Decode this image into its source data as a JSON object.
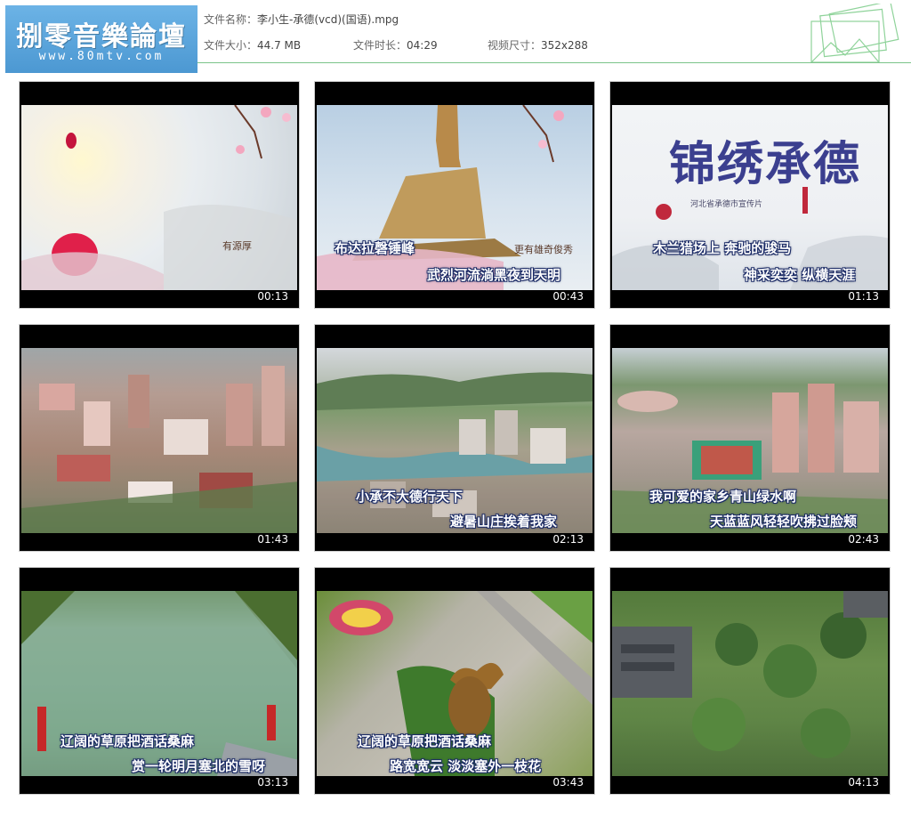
{
  "header": {
    "logo_title": "捌零音樂論壇",
    "logo_url": "www.80mtv.com",
    "file_name_label": "文件名称：",
    "file_name": "李小生-承德(vcd)(国语).mpg",
    "file_size_label": "文件大小：",
    "file_size": "44.7 MB",
    "duration_label": "文件时长：",
    "duration": "04:29",
    "dimensions_label": "视频尺寸：",
    "dimensions": "352x288"
  },
  "thumbnails": [
    {
      "time": "00:13",
      "sub1": "",
      "sub2": "",
      "overlay": "有源厚"
    },
    {
      "time": "00:43",
      "sub1": "布达拉磬锤峰",
      "sub2": "武烈河流淌黑夜到天明",
      "overlay": "更有雄奇俊秀"
    },
    {
      "time": "01:13",
      "sub1": "木兰猎场上 奔驰的骏马",
      "sub2": "神采奕奕 纵横天涯",
      "overlay": "锦绣承德",
      "overlay_small": "河北省承德市宣传片"
    },
    {
      "time": "01:43",
      "sub1": "",
      "sub2": ""
    },
    {
      "time": "02:13",
      "sub1": "小承不大德行天下",
      "sub2": "避暑山庄挨着我家"
    },
    {
      "time": "02:43",
      "sub1": "我可爱的家乡青山绿水啊",
      "sub2": "天蓝蓝风轻轻吹拂过脸颊"
    },
    {
      "time": "03:13",
      "sub1": "辽阔的草原把酒话桑麻",
      "sub2": "赏一轮明月塞北的雪呀"
    },
    {
      "time": "03:43",
      "sub1": "辽阔的草原把酒话桑麻",
      "sub2": "路宽宽云 淡淡塞外一枝花"
    },
    {
      "time": "04:13",
      "sub1": "",
      "sub2": ""
    }
  ],
  "colors": {
    "logo_bg": "#5aa6dd",
    "rule": "#7cc48a",
    "subtitle_highlight": "#7fe0ff"
  }
}
